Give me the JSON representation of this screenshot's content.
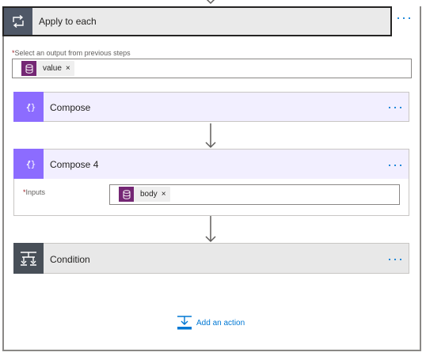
{
  "loop": {
    "title": "Apply to each",
    "select_label": "Select an output from previous steps",
    "required_marker": "*",
    "token": {
      "label": "value",
      "remove": "×",
      "icon": "database-icon"
    }
  },
  "compose1": {
    "title": "Compose",
    "icon": "code-braces-icon"
  },
  "compose2": {
    "title": "Compose 4",
    "icon": "code-braces-icon",
    "inputs_label": "Inputs",
    "required_marker": "*",
    "token": {
      "label": "body",
      "remove": "×",
      "icon": "database-icon"
    }
  },
  "condition": {
    "title": "Condition",
    "icon": "condition-branch-icon"
  },
  "more_label": "···",
  "add_action": {
    "label": "Add an action",
    "icon": "add-action-icon"
  },
  "colors": {
    "accent": "#0078d4",
    "compose": "#8c6cff",
    "compose_bg": "#f2efff",
    "token_icon": "#742774",
    "loop_icon": "#4f5867",
    "condition_icon": "#484f58",
    "required": "#a4262c"
  }
}
